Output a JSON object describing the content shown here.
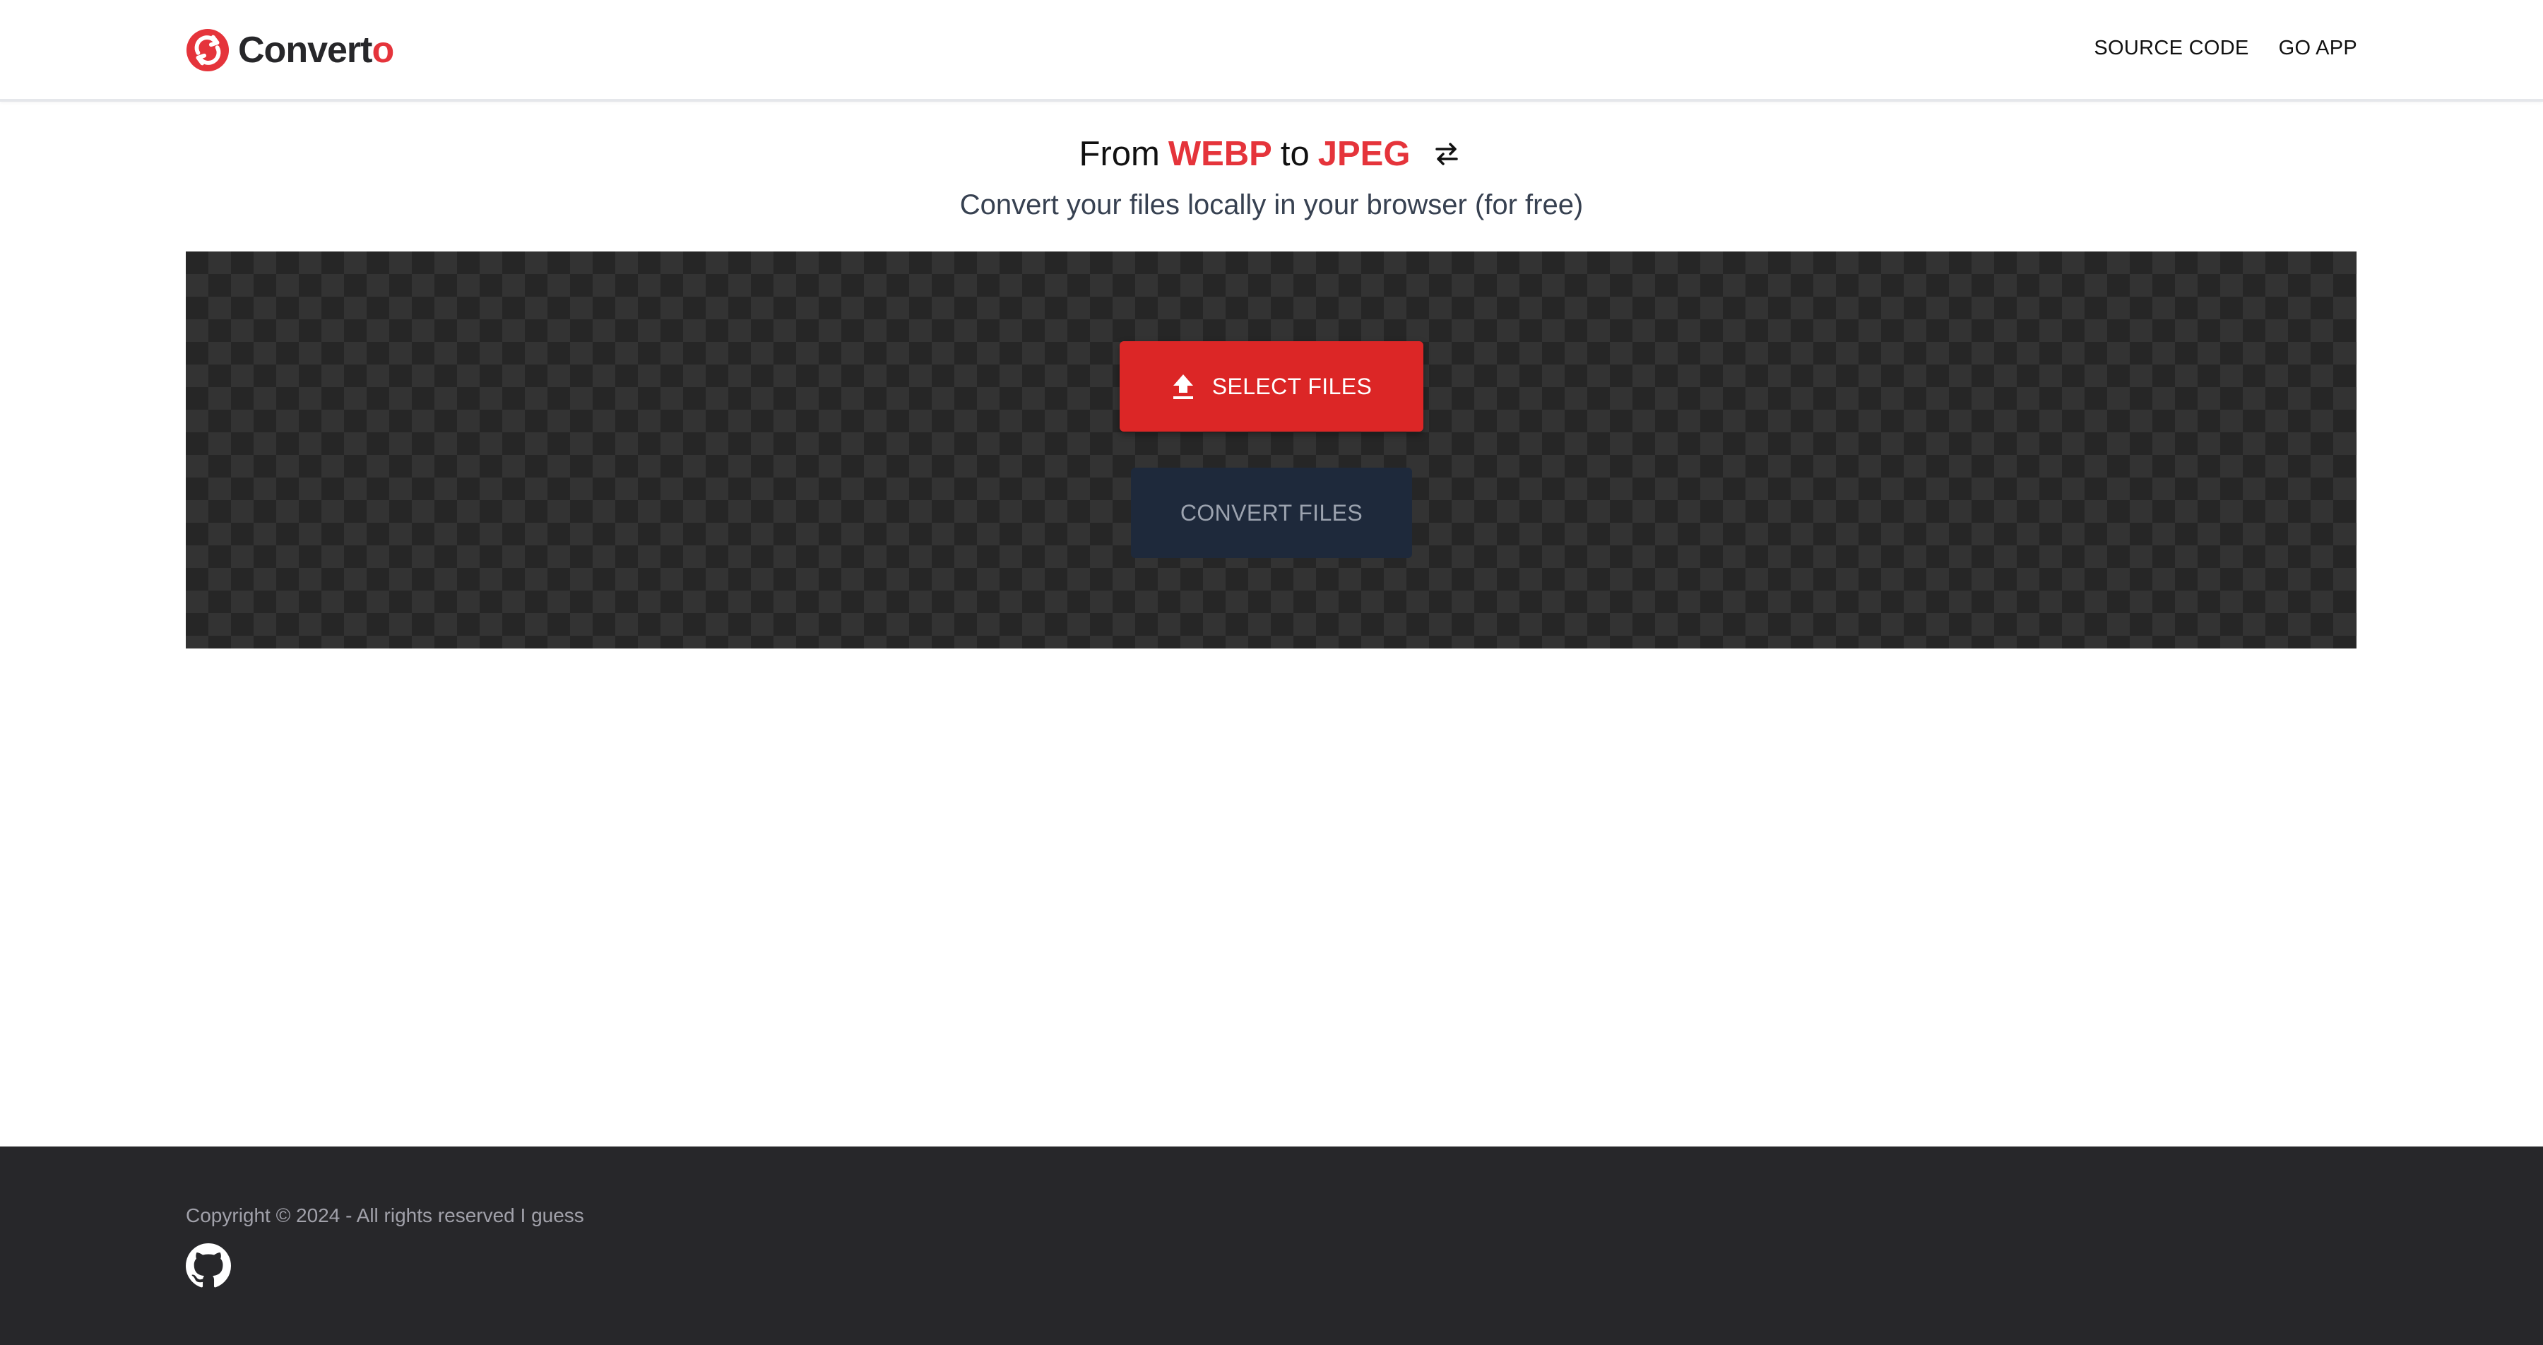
{
  "header": {
    "brand": {
      "name_main": "Convert",
      "name_accent": "o",
      "logo_icon": "refresh-circle-icon"
    },
    "nav": [
      {
        "label": "SOURCE CODE"
      },
      {
        "label": "GO APP"
      }
    ]
  },
  "hero": {
    "from_word": "From",
    "from_format": "WEBP",
    "to_word": "to",
    "to_format": "JPEG",
    "swap_icon": "swap-arrows-icon",
    "subtitle": "Convert your files locally in your browser (for free)"
  },
  "actions": {
    "select_label": "SELECT FILES",
    "select_icon": "upload-icon",
    "convert_label": "CONVERT FILES"
  },
  "footer": {
    "copyright": "Copyright © 2024 - All rights reserved I guess",
    "github_icon": "github-icon"
  },
  "colors": {
    "accent": "#e5343b",
    "select_button": "#dc2626",
    "convert_button": "#1e293b",
    "drop_area_dark": "#262626",
    "drop_area_light": "#333333",
    "footer_bg": "#27272a"
  }
}
